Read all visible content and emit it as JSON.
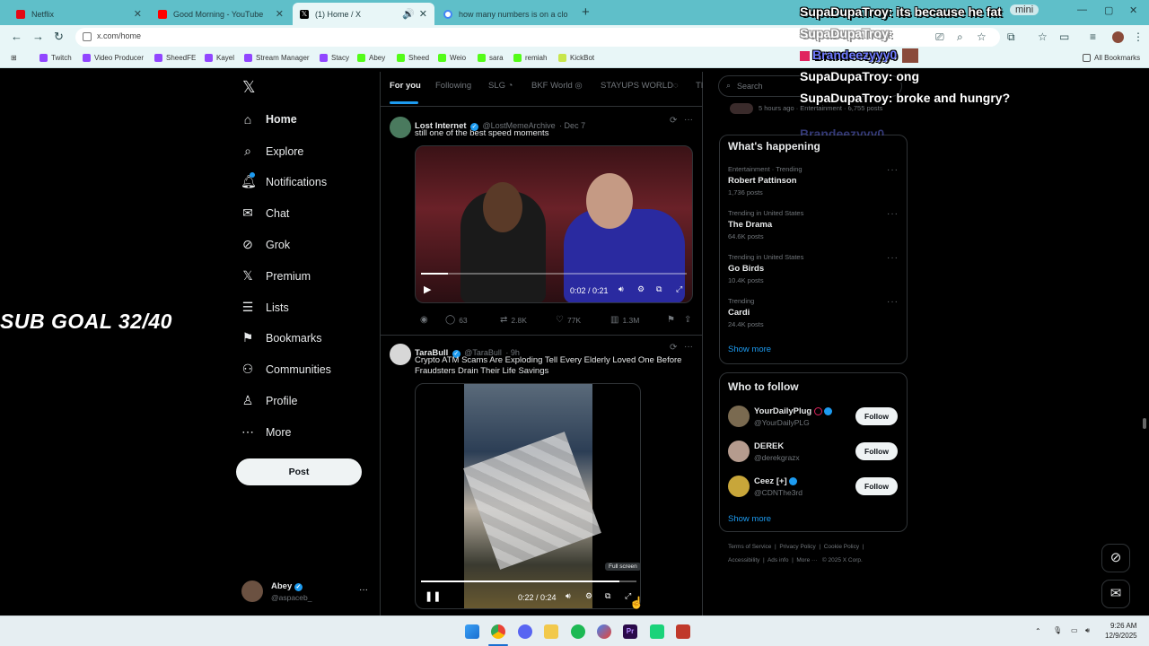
{
  "browser": {
    "tabs": [
      {
        "label": "Netflix",
        "favicon_color": "#e50914"
      },
      {
        "label": "Good Morning - YouTube",
        "favicon_color": "#ff0000"
      },
      {
        "label": "(1) Home / X",
        "favicon_color": "#000000"
      },
      {
        "label": "how many numbers is on a clo",
        "favicon_color": "#4285f4"
      }
    ],
    "url": "x.com/home",
    "bookmarks": [
      {
        "label": "Twitch",
        "color": "#9146ff"
      },
      {
        "label": "Video Producer",
        "color": "#9146ff"
      },
      {
        "label": "SheedFE",
        "color": "#9146ff"
      },
      {
        "label": "Kayel",
        "color": "#9146ff"
      },
      {
        "label": "Stream Manager",
        "color": "#9146ff"
      },
      {
        "label": "Stacy",
        "color": "#9146ff"
      },
      {
        "label": "Abey",
        "color": "#53fc18"
      },
      {
        "label": "Sheed",
        "color": "#53fc18"
      },
      {
        "label": "Weio",
        "color": "#53fc18"
      },
      {
        "label": "sara",
        "color": "#53fc18"
      },
      {
        "label": "remiah",
        "color": "#53fc18"
      },
      {
        "label": "KickBot",
        "color": "#c8e64b"
      }
    ],
    "all_bookmarks": "All Bookmarks",
    "mini_label": "mini"
  },
  "overlay": {
    "sub_goal": "SUB GOAL 32/40",
    "chat": [
      {
        "user": "SupaDupaTroy:",
        "msg": " its because he fat",
        "user_color": "#ffffff"
      },
      {
        "user": "SupaDupaTroy:",
        "msg": "",
        "user_color": "#ffffff"
      },
      {
        "user": "Brandeezyyy0",
        "msg": "",
        "user_color": "#6f7bff"
      },
      {
        "user": "SupaDupaTroy:",
        "msg": " ong",
        "user_color": "#ffffff"
      },
      {
        "user": "SupaDupaTroy:",
        "msg": " broke and hungry?",
        "user_color": "#ffffff"
      },
      {
        "user": "Brandeezyyy0",
        "msg": "",
        "user_color": "#6f7bff"
      }
    ]
  },
  "nav": {
    "items": [
      {
        "label": "Home",
        "icon": "⌂"
      },
      {
        "label": "Explore",
        "icon": "⌕"
      },
      {
        "label": "Notifications",
        "icon": "♪"
      },
      {
        "label": "Chat",
        "icon": "✉"
      },
      {
        "label": "Grok",
        "icon": "⊘"
      },
      {
        "label": "Premium",
        "icon": "𝕏"
      },
      {
        "label": "Lists",
        "icon": "☰"
      },
      {
        "label": "Bookmarks",
        "icon": "⚑"
      },
      {
        "label": "Communities",
        "icon": "⚇"
      },
      {
        "label": "Profile",
        "icon": "♙"
      },
      {
        "label": "More",
        "icon": "⋯"
      }
    ],
    "post": "Post",
    "account": {
      "name": "Abey",
      "handle": "@aspaceb_"
    }
  },
  "feed": {
    "tabs": [
      "For you",
      "Following",
      "SLG",
      "BKF World",
      "STAYUPS WORLD",
      "TI"
    ],
    "tweets": [
      {
        "name": "Lost Internet",
        "handle": "@LostMemeArchive",
        "time": "· Dec 7",
        "text": "still one of the best speed moments",
        "video_time": "0:02 / 0:21",
        "progress": 0.1,
        "stats": {
          "replies": "63",
          "reposts": "2.8K",
          "likes": "77K",
          "views": "1.3M"
        }
      },
      {
        "name": "TaraBull",
        "handle": "@TaraBull",
        "time": "· 9h",
        "text": "Crypto ATM Scams Are Exploding  Tell Every Elderly Loved One Before Fraudsters Drain Their Life Savings",
        "video_time": "0:22 / 0:24",
        "progress": 0.92,
        "tooltip": "Full screen"
      }
    ]
  },
  "sidebar": {
    "search_placeholder": "Search",
    "peek_text": "5 hours ago · Entertainment · 6,755 posts",
    "whats_happening": "What's happening",
    "trends": [
      {
        "category": "Entertainment · Trending",
        "name": "Robert Pattinson",
        "count": "1,736 posts"
      },
      {
        "category": "Trending in United States",
        "name": "The Drama",
        "count": "64.6K posts"
      },
      {
        "category": "Trending in United States",
        "name": "Go Birds",
        "count": "10.4K posts"
      },
      {
        "category": "Trending",
        "name": "Cardi",
        "count": "24.4K posts"
      }
    ],
    "show_more": "Show more",
    "who_to_follow": "Who to follow",
    "follow_suggestions": [
      {
        "name": "YourDailyPlug",
        "handle": "@YourDailyPLG",
        "button": "Follow"
      },
      {
        "name": "DEREK",
        "handle": "@derekgrazx",
        "button": "Follow"
      },
      {
        "name": "Ceez [+]",
        "handle": "@CDNThe3rd",
        "button": "Follow"
      }
    ],
    "footer1": [
      "Terms of Service",
      "Privacy Policy",
      "Cookie Policy"
    ],
    "footer2": [
      "Accessibility",
      "Ads info",
      "More ···",
      "© 2025 X Corp."
    ]
  },
  "taskbar": {
    "time": "9:26 AM",
    "date": "12/9/2025"
  }
}
